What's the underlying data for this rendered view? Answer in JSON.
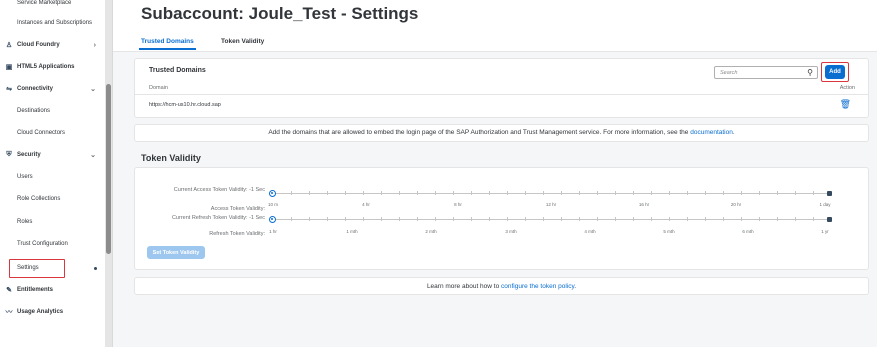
{
  "sidebar": {
    "items": [
      {
        "label": "Service Marketplace",
        "kind": "sub"
      },
      {
        "label": "Instances and Subscriptions",
        "kind": "sub"
      },
      {
        "label": "Cloud Foundry",
        "kind": "group",
        "icon": "cloud-foundry-icon",
        "chevron": "›"
      },
      {
        "label": "HTML5 Applications",
        "kind": "group",
        "icon": "html5-icon"
      },
      {
        "label": "Connectivity",
        "kind": "group",
        "icon": "connectivity-icon",
        "chevron": "⌄"
      },
      {
        "label": "Destinations",
        "kind": "sub"
      },
      {
        "label": "Cloud Connectors",
        "kind": "sub"
      },
      {
        "label": "Security",
        "kind": "group",
        "icon": "security-icon",
        "chevron": "⌄"
      },
      {
        "label": "Users",
        "kind": "sub"
      },
      {
        "label": "Role Collections",
        "kind": "sub"
      },
      {
        "label": "Roles",
        "kind": "sub"
      },
      {
        "label": "Trust Configuration",
        "kind": "sub"
      },
      {
        "label": "Settings",
        "kind": "sub",
        "selected": true
      },
      {
        "label": "Entitlements",
        "kind": "group",
        "icon": "entitlements-icon"
      },
      {
        "label": "Usage Analytics",
        "kind": "group",
        "icon": "usage-analytics-icon"
      }
    ]
  },
  "header": {
    "title": "Subaccount: Joule_Test - Settings",
    "tabs": [
      {
        "label": "Trusted Domains",
        "active": true
      },
      {
        "label": "Token Validity",
        "active": false
      }
    ]
  },
  "trusted_domains": {
    "title": "Trusted Domains",
    "search_placeholder": "Search",
    "add_label": "Add",
    "columns": [
      "Domain",
      "Action"
    ],
    "rows": [
      {
        "domain": "https://hcm-us10.hr.cloud.sap"
      }
    ]
  },
  "info": {
    "text": "Add the domains that are allowed to embed the login page of the SAP Authorization and Trust Management service. For more information, see the ",
    "link": "documentation",
    "suffix": "."
  },
  "token_validity": {
    "title": "Token Validity",
    "access_current_label": "Current Access Token Validity: -1 Sec",
    "access_label": "Access Token Validity:",
    "access_ticks": [
      "10 m",
      "4 hr",
      "8 hr",
      "12 hr",
      "16 hr",
      "20 hr",
      "1 day"
    ],
    "refresh_current_label": "Current Refresh Token Validity: -1 Sec",
    "refresh_label": "Refresh Token Validity:",
    "refresh_ticks": [
      "1 hr",
      "1 mth",
      "2 mth",
      "3 mth",
      "4 mth",
      "5 mth",
      "6 mth",
      "1 yr"
    ],
    "button_label": "Set Token Validity"
  },
  "learn": {
    "text": "Learn more about how to ",
    "link": "configure the token policy",
    "suffix": "."
  }
}
